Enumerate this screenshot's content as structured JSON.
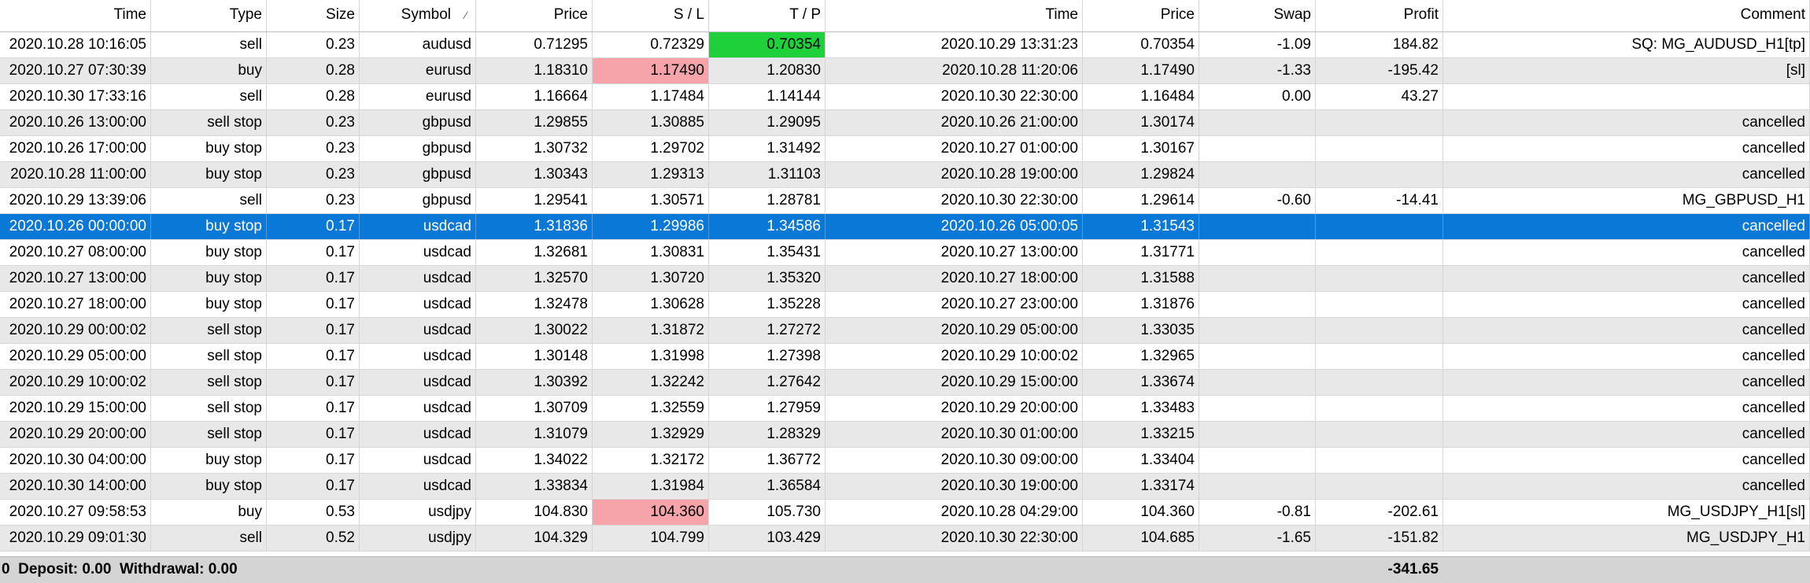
{
  "header": {
    "columns": [
      "Time",
      "Type",
      "Size",
      "Symbol",
      "Price",
      "S / L",
      "T / P",
      "Time",
      "Price",
      "Swap",
      "Profit",
      "Comment"
    ],
    "sort_indicator": "⁄"
  },
  "rows": [
    {
      "open_time": "2020.10.28 10:16:05",
      "type": "sell",
      "size": "0.23",
      "symbol": "audusd",
      "price": "0.71295",
      "sl": "0.72329",
      "tp": "0.70354",
      "close_time": "2020.10.29 13:31:23",
      "close_price": "0.70354",
      "swap": "-1.09",
      "profit": "184.82",
      "comment": "SQ: MG_AUDUSD_H1[tp]",
      "tp_hit": true
    },
    {
      "open_time": "2020.10.27 07:30:39",
      "type": "buy",
      "size": "0.28",
      "symbol": "eurusd",
      "price": "1.18310",
      "sl": "1.17490",
      "tp": "1.20830",
      "close_time": "2020.10.28 11:20:06",
      "close_price": "1.17490",
      "swap": "-1.33",
      "profit": "-195.42",
      "comment": "[sl]",
      "sl_hit": true
    },
    {
      "open_time": "2020.10.30 17:33:16",
      "type": "sell",
      "size": "0.28",
      "symbol": "eurusd",
      "price": "1.16664",
      "sl": "1.17484",
      "tp": "1.14144",
      "close_time": "2020.10.30 22:30:00",
      "close_price": "1.16484",
      "swap": "0.00",
      "profit": "43.27",
      "comment": ""
    },
    {
      "open_time": "2020.10.26 13:00:00",
      "type": "sell stop",
      "size": "0.23",
      "symbol": "gbpusd",
      "price": "1.29855",
      "sl": "1.30885",
      "tp": "1.29095",
      "close_time": "2020.10.26 21:00:00",
      "close_price": "1.30174",
      "swap": "",
      "profit": "",
      "comment": "cancelled"
    },
    {
      "open_time": "2020.10.26 17:00:00",
      "type": "buy stop",
      "size": "0.23",
      "symbol": "gbpusd",
      "price": "1.30732",
      "sl": "1.29702",
      "tp": "1.31492",
      "close_time": "2020.10.27 01:00:00",
      "close_price": "1.30167",
      "swap": "",
      "profit": "",
      "comment": "cancelled"
    },
    {
      "open_time": "2020.10.28 11:00:00",
      "type": "buy stop",
      "size": "0.23",
      "symbol": "gbpusd",
      "price": "1.30343",
      "sl": "1.29313",
      "tp": "1.31103",
      "close_time": "2020.10.28 19:00:00",
      "close_price": "1.29824",
      "swap": "",
      "profit": "",
      "comment": "cancelled"
    },
    {
      "open_time": "2020.10.29 13:39:06",
      "type": "sell",
      "size": "0.23",
      "symbol": "gbpusd",
      "price": "1.29541",
      "sl": "1.30571",
      "tp": "1.28781",
      "close_time": "2020.10.30 22:30:00",
      "close_price": "1.29614",
      "swap": "-0.60",
      "profit": "-14.41",
      "comment": "MG_GBPUSD_H1"
    },
    {
      "open_time": "2020.10.26 00:00:00",
      "type": "buy stop",
      "size": "0.17",
      "symbol": "usdcad",
      "price": "1.31836",
      "sl": "1.29986",
      "tp": "1.34586",
      "close_time": "2020.10.26 05:00:05",
      "close_price": "1.31543",
      "swap": "",
      "profit": "",
      "comment": "cancelled",
      "selected": true
    },
    {
      "open_time": "2020.10.27 08:00:00",
      "type": "buy stop",
      "size": "0.17",
      "symbol": "usdcad",
      "price": "1.32681",
      "sl": "1.30831",
      "tp": "1.35431",
      "close_time": "2020.10.27 13:00:00",
      "close_price": "1.31771",
      "swap": "",
      "profit": "",
      "comment": "cancelled"
    },
    {
      "open_time": "2020.10.27 13:00:00",
      "type": "buy stop",
      "size": "0.17",
      "symbol": "usdcad",
      "price": "1.32570",
      "sl": "1.30720",
      "tp": "1.35320",
      "close_time": "2020.10.27 18:00:00",
      "close_price": "1.31588",
      "swap": "",
      "profit": "",
      "comment": "cancelled"
    },
    {
      "open_time": "2020.10.27 18:00:00",
      "type": "buy stop",
      "size": "0.17",
      "symbol": "usdcad",
      "price": "1.32478",
      "sl": "1.30628",
      "tp": "1.35228",
      "close_time": "2020.10.27 23:00:00",
      "close_price": "1.31876",
      "swap": "",
      "profit": "",
      "comment": "cancelled"
    },
    {
      "open_time": "2020.10.29 00:00:02",
      "type": "sell stop",
      "size": "0.17",
      "symbol": "usdcad",
      "price": "1.30022",
      "sl": "1.31872",
      "tp": "1.27272",
      "close_time": "2020.10.29 05:00:00",
      "close_price": "1.33035",
      "swap": "",
      "profit": "",
      "comment": "cancelled"
    },
    {
      "open_time": "2020.10.29 05:00:00",
      "type": "sell stop",
      "size": "0.17",
      "symbol": "usdcad",
      "price": "1.30148",
      "sl": "1.31998",
      "tp": "1.27398",
      "close_time": "2020.10.29 10:00:02",
      "close_price": "1.32965",
      "swap": "",
      "profit": "",
      "comment": "cancelled"
    },
    {
      "open_time": "2020.10.29 10:00:02",
      "type": "sell stop",
      "size": "0.17",
      "symbol": "usdcad",
      "price": "1.30392",
      "sl": "1.32242",
      "tp": "1.27642",
      "close_time": "2020.10.29 15:00:00",
      "close_price": "1.33674",
      "swap": "",
      "profit": "",
      "comment": "cancelled"
    },
    {
      "open_time": "2020.10.29 15:00:00",
      "type": "sell stop",
      "size": "0.17",
      "symbol": "usdcad",
      "price": "1.30709",
      "sl": "1.32559",
      "tp": "1.27959",
      "close_time": "2020.10.29 20:00:00",
      "close_price": "1.33483",
      "swap": "",
      "profit": "",
      "comment": "cancelled"
    },
    {
      "open_time": "2020.10.29 20:00:00",
      "type": "sell stop",
      "size": "0.17",
      "symbol": "usdcad",
      "price": "1.31079",
      "sl": "1.32929",
      "tp": "1.28329",
      "close_time": "2020.10.30 01:00:00",
      "close_price": "1.33215",
      "swap": "",
      "profit": "",
      "comment": "cancelled"
    },
    {
      "open_time": "2020.10.30 04:00:00",
      "type": "buy stop",
      "size": "0.17",
      "symbol": "usdcad",
      "price": "1.34022",
      "sl": "1.32172",
      "tp": "1.36772",
      "close_time": "2020.10.30 09:00:00",
      "close_price": "1.33404",
      "swap": "",
      "profit": "",
      "comment": "cancelled"
    },
    {
      "open_time": "2020.10.30 14:00:00",
      "type": "buy stop",
      "size": "0.17",
      "symbol": "usdcad",
      "price": "1.33834",
      "sl": "1.31984",
      "tp": "1.36584",
      "close_time": "2020.10.30 19:00:00",
      "close_price": "1.33174",
      "swap": "",
      "profit": "",
      "comment": "cancelled"
    },
    {
      "open_time": "2020.10.27 09:58:53",
      "type": "buy",
      "size": "0.53",
      "symbol": "usdjpy",
      "price": "104.830",
      "sl": "104.360",
      "tp": "105.730",
      "close_time": "2020.10.28 04:29:00",
      "close_price": "104.360",
      "swap": "-0.81",
      "profit": "-202.61",
      "comment": "MG_USDJPY_H1[sl]",
      "sl_hit": true
    },
    {
      "open_time": "2020.10.29 09:01:30",
      "type": "sell",
      "size": "0.52",
      "symbol": "usdjpy",
      "price": "104.329",
      "sl": "104.799",
      "tp": "103.429",
      "close_time": "2020.10.30 22:30:00",
      "close_price": "104.685",
      "swap": "-1.65",
      "profit": "-151.82",
      "comment": "MG_USDJPY_H1"
    }
  ],
  "summary": {
    "text": "0  Deposit: 0.00  Withdrawal: 0.00",
    "total_profit": "-341.65"
  },
  "colors": {
    "selected_row": "#0a78d7",
    "stop_loss_hit": "#f6a3a9",
    "take_profit_hit": "#1ed03a",
    "alt_row": "#e8e8e8"
  }
}
